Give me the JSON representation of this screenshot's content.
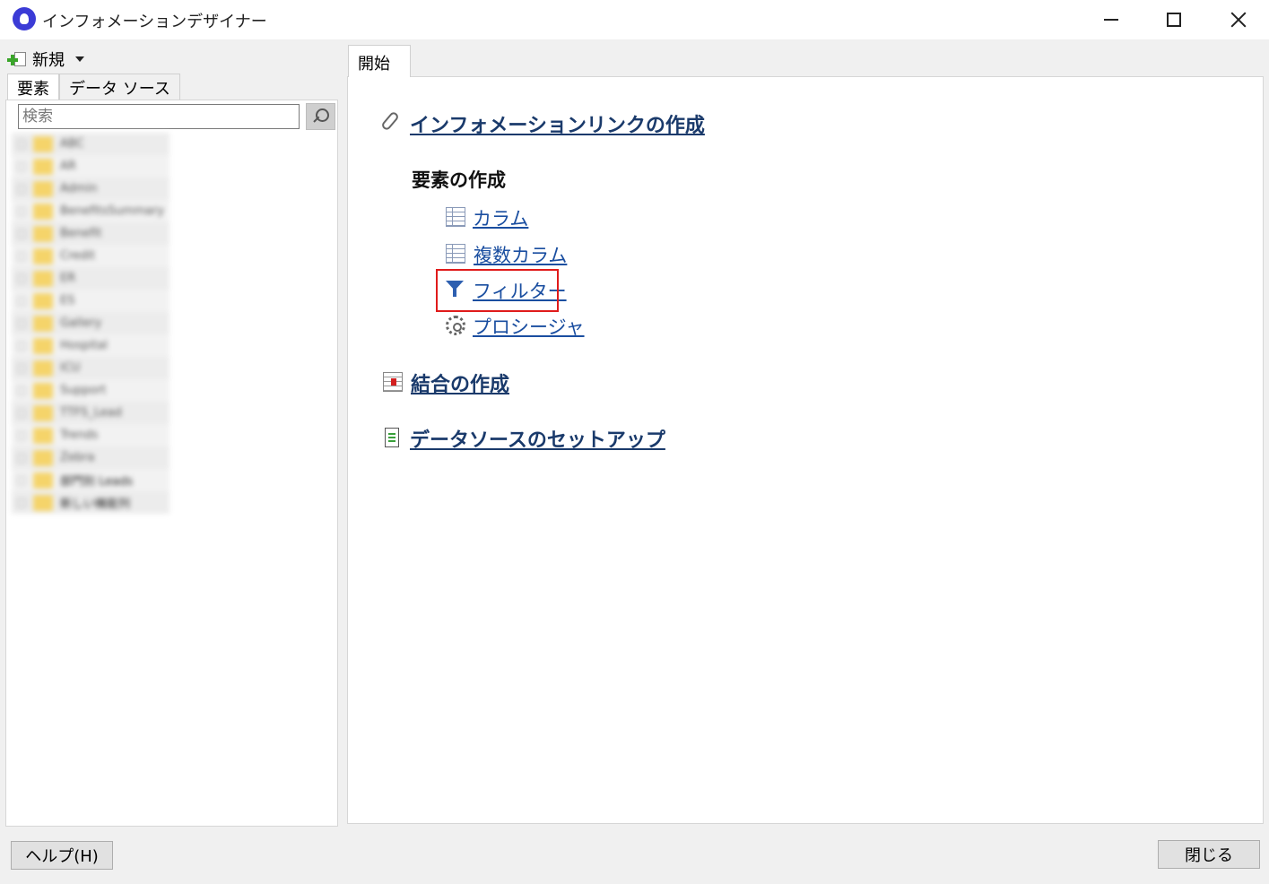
{
  "window": {
    "title": "インフォメーションデザイナー",
    "icon": "lightbulb-icon"
  },
  "left": {
    "new_label": "新規",
    "tabs": [
      "要素",
      "データ ソース"
    ],
    "search": {
      "placeholder": "検索",
      "value": ""
    },
    "tree_items": [
      {
        "label": "ABC"
      },
      {
        "label": "AR"
      },
      {
        "label": "Admin"
      },
      {
        "label": "BenefitsSummary"
      },
      {
        "label": "Benefit"
      },
      {
        "label": "Credit"
      },
      {
        "label": "ER"
      },
      {
        "label": "ES"
      },
      {
        "label": "Gallery"
      },
      {
        "label": "Hospital"
      },
      {
        "label": "ICU"
      },
      {
        "label": "Support"
      },
      {
        "label": "TTFS_Lead"
      },
      {
        "label": "Trends"
      },
      {
        "label": "Zebra"
      },
      {
        "label": "部門別 Leads"
      },
      {
        "label": "新しい機能列"
      }
    ]
  },
  "right": {
    "tab_label": "開始",
    "links": {
      "info_link": "インフォメーションリンクの作成",
      "section_elements": "要素の作成",
      "column": "カラム",
      "multi_column": "複数カラム",
      "filter": "フィルター",
      "procedure": "プロシージャ",
      "join": "結合の作成",
      "datasource_setup": "データソースのセットアップ"
    }
  },
  "footer": {
    "help_label": "ヘルプ(H)",
    "close_label": "閉じる"
  },
  "colors": {
    "link": "#1a4ea0",
    "highlight": "#e01b1b"
  }
}
